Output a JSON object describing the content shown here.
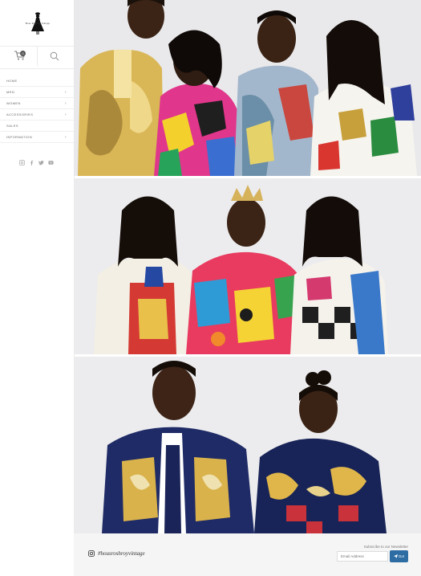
{
  "brand": {
    "logo_text": "Hose Royalty Vintage"
  },
  "header": {
    "cart_count": "0",
    "cart_icon": "cart-icon",
    "search_icon": "search-icon"
  },
  "nav": {
    "items": [
      {
        "label": "HOME",
        "has_children": false
      },
      {
        "label": "MEN",
        "has_children": true
      },
      {
        "label": "WOMEN",
        "has_children": true
      },
      {
        "label": "ACCESSORIES",
        "has_children": true
      },
      {
        "label": "SALES",
        "has_children": false
      },
      {
        "label": "INFORMATION",
        "has_children": true
      }
    ],
    "chevron": "›"
  },
  "social": [
    "instagram-icon",
    "facebook-icon",
    "twitter-icon",
    "youtube-icon"
  ],
  "photos": [
    {
      "description_icon": "photo-group-four"
    },
    {
      "description_icon": "photo-group-three"
    },
    {
      "description_icon": "photo-group-two"
    }
  ],
  "footer": {
    "instagram_handle": "#housroshroyvintage",
    "newsletter_label": "Subscribe to our Newsletter",
    "email_placeholder": "Email Address",
    "go_label": "Go!"
  },
  "colors": {
    "accent": "#2e6da4",
    "footer_bg": "#f5f5f5",
    "photo_bg": "#ebebed"
  }
}
